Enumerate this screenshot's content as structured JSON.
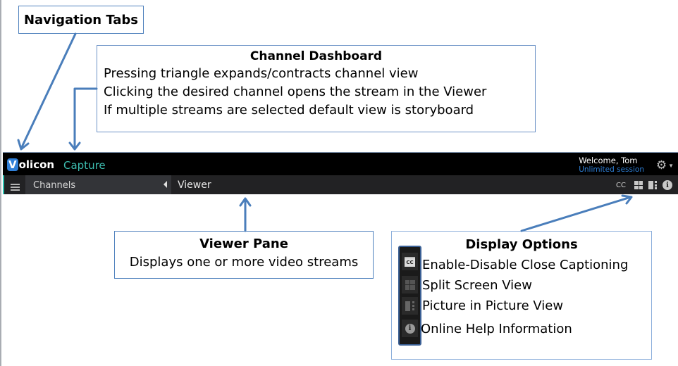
{
  "annotations": {
    "navigation_tabs": {
      "title": "Navigation Tabs"
    },
    "channel_dashboard": {
      "title": "Channel Dashboard",
      "lines": [
        "Pressing triangle expands/contracts channel view",
        "Clicking the desired channel opens the stream in the Viewer",
        "If multiple streams are selected default view is storyboard"
      ]
    },
    "viewer_pane": {
      "title": "Viewer Pane",
      "lines": [
        "Displays one or more video streams"
      ]
    },
    "display_options": {
      "title": "Display Options",
      "items": [
        {
          "icon": "closed-caption-icon",
          "label": "Enable-Disable Close Captioning"
        },
        {
          "icon": "split-screen-icon",
          "label": "Split Screen View"
        },
        {
          "icon": "picture-in-picture-icon",
          "label": "Picture in Picture View"
        },
        {
          "icon": "info-icon",
          "label": "Online Help Information"
        }
      ]
    }
  },
  "app": {
    "logo_v": "V",
    "logo_rest": "olicon",
    "app_name": "Capture",
    "welcome": "Welcome, Tom",
    "session": "Unlimited session",
    "settings_icon": "gear-icon",
    "channels_label": "Channels",
    "viewer_label": "Viewer",
    "cc_label": "CC",
    "info_glyph": "i",
    "colors": {
      "accent_teal": "#3dbdb0",
      "brand_blue": "#2f7fd8",
      "session_blue": "#2e7fd6",
      "callout_border": "#4f81bd"
    }
  }
}
